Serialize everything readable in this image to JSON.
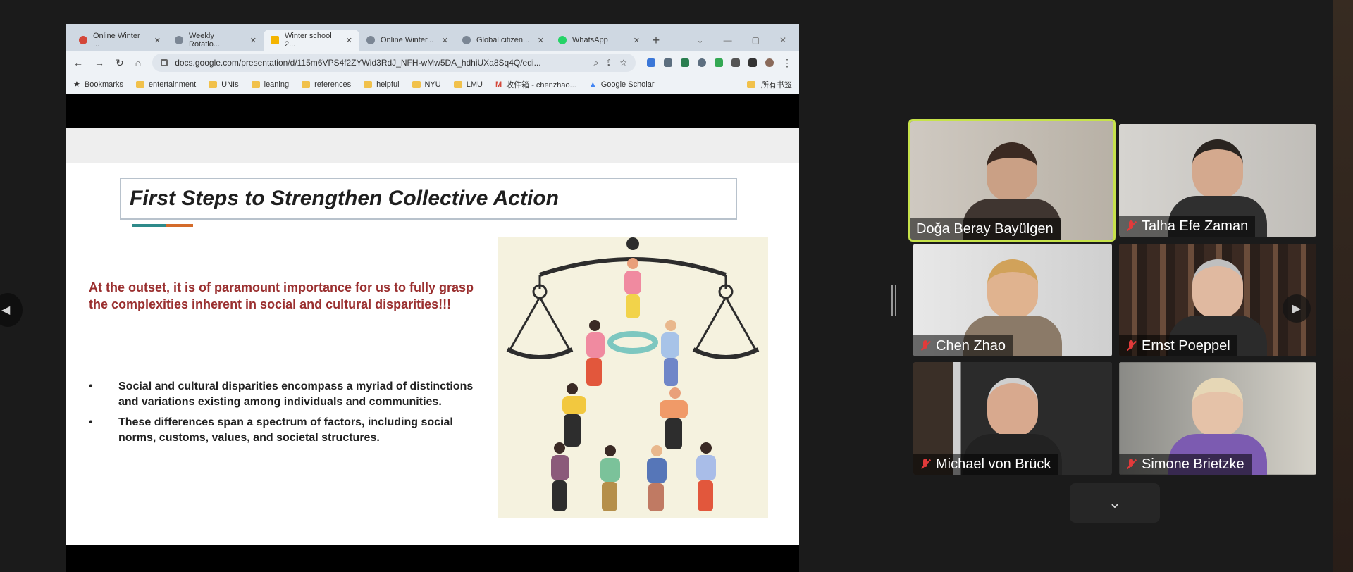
{
  "browser": {
    "tabs": [
      {
        "label": "Online Winter ...",
        "icon": "gmail-icon"
      },
      {
        "label": "Weekly Rotatio...",
        "icon": "web-icon"
      },
      {
        "label": "Winter school 2...",
        "icon": "slides-icon",
        "active": true
      },
      {
        "label": "Online Winter...",
        "icon": "web-icon"
      },
      {
        "label": "Global citizen...",
        "icon": "web-icon"
      },
      {
        "label": "WhatsApp",
        "icon": "whatsapp-icon"
      }
    ],
    "new_tab_label": "+",
    "url": "docs.google.com/presentation/d/115m6VPS4f2ZYWid3RdJ_NFH-wMw5DA_hdhiUXa8Sq4Q/edi...",
    "bookmarks": [
      {
        "label": "Bookmarks",
        "icon": "star-icon"
      },
      {
        "label": "entertainment",
        "icon": "folder-icon"
      },
      {
        "label": "UNIs",
        "icon": "folder-icon"
      },
      {
        "label": "leaning",
        "icon": "folder-icon"
      },
      {
        "label": "references",
        "icon": "folder-icon"
      },
      {
        "label": "helpful",
        "icon": "folder-icon"
      },
      {
        "label": "NYU",
        "icon": "folder-icon"
      },
      {
        "label": "LMU",
        "icon": "folder-icon"
      },
      {
        "label": "收件箱 - chenzhao...",
        "icon": "gmail-icon"
      },
      {
        "label": "Google Scholar",
        "icon": "scholar-icon"
      }
    ],
    "other_bookmarks": "所有书签"
  },
  "slide": {
    "title": "First Steps to Strengthen Collective Action",
    "lead": "At the outset, it is of paramount importance for us to fully grasp the complexities inherent in social and cultural disparities!!!",
    "bullets": [
      "Social and cultural disparities encompass a myriad of distinctions and variations existing among individuals and communities.",
      "These differences span a spectrum of factors, including social norms, customs, values, and societal structures."
    ],
    "colors": {
      "lead": "#9a2f2f",
      "accent_teal": "#2f8a8a",
      "accent_orange": "#d46b2a"
    }
  },
  "participants": [
    {
      "name": "Doğa Beray Bayülgen",
      "muted": false,
      "speaking": true
    },
    {
      "name": "Talha Efe Zaman",
      "muted": true,
      "speaking": false
    },
    {
      "name": "Chen Zhao",
      "muted": true,
      "speaking": false
    },
    {
      "name": "Ernst Poeppel",
      "muted": true,
      "speaking": false
    },
    {
      "name": "Michael von Brück",
      "muted": true,
      "speaking": false
    },
    {
      "name": "Simone Brietzke",
      "muted": true,
      "speaking": false
    }
  ],
  "controls": {
    "left_nav": "◀",
    "tile_next": "▶",
    "expand": "⌄"
  }
}
